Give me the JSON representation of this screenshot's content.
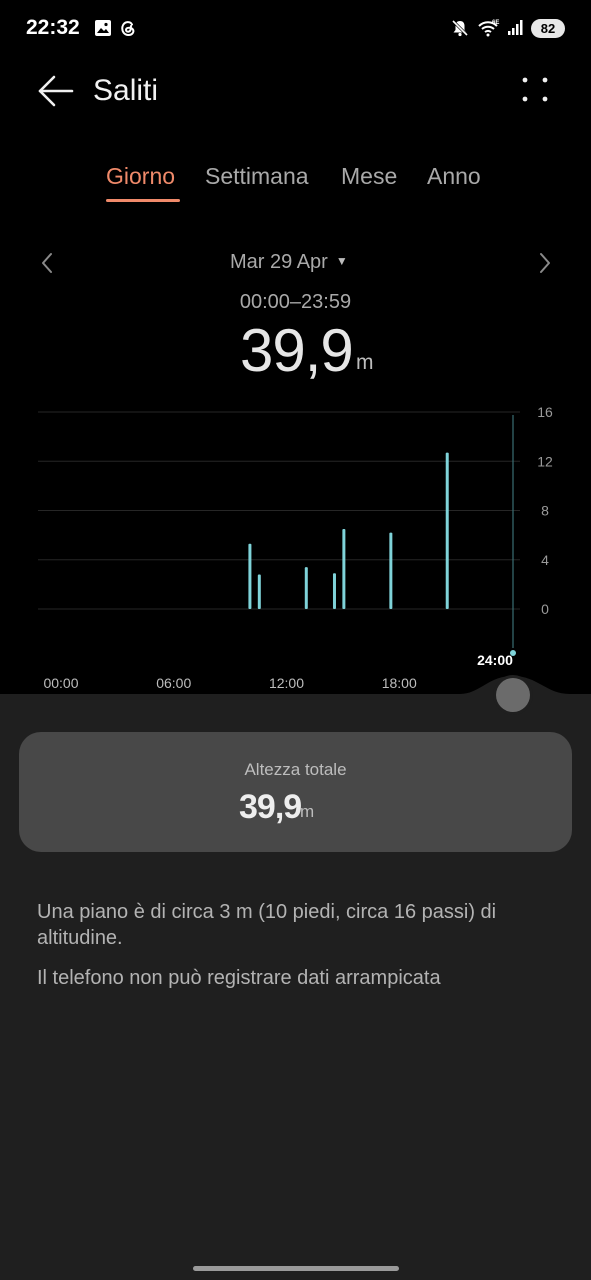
{
  "status_bar": {
    "time": "22:32",
    "battery": "82",
    "icons": [
      "gallery-icon",
      "threads-icon",
      "mute-icon",
      "wifi-6e-icon",
      "signal-icon"
    ]
  },
  "app_bar": {
    "title": "Saliti",
    "back_icon": "arrow-left-icon",
    "menu_icon": "more-dots-icon"
  },
  "tabs": [
    {
      "label": "Giorno",
      "active": true
    },
    {
      "label": "Settimana",
      "active": false
    },
    {
      "label": "Mese",
      "active": false
    },
    {
      "label": "Anno",
      "active": false
    }
  ],
  "date_nav": {
    "date": "Mar 29 Apr",
    "time_range": "00:00–23:59",
    "value": "39,9",
    "unit": "m"
  },
  "chart_data": {
    "type": "bar",
    "x_ticks": [
      "00:00",
      "06:00",
      "12:00",
      "18:00"
    ],
    "cursor_label": "24:00",
    "y_ticks": [
      "16",
      "12",
      "8",
      "4",
      "0"
    ],
    "ylim": [
      0,
      16
    ],
    "xlim_hours": [
      0,
      24
    ],
    "bar_color": "#7fd3d9",
    "points": [
      {
        "hour": 10.0,
        "value": 5.3
      },
      {
        "hour": 10.5,
        "value": 2.8
      },
      {
        "hour": 13.0,
        "value": 3.4
      },
      {
        "hour": 14.5,
        "value": 2.9
      },
      {
        "hour": 15.0,
        "value": 6.5
      },
      {
        "hour": 17.5,
        "value": 6.2
      },
      {
        "hour": 20.5,
        "value": 12.7
      }
    ]
  },
  "summary": {
    "label": "Altezza totale",
    "value": "39,9",
    "unit": "m"
  },
  "info": [
    "Una piano è di circa 3 m (10 piedi, circa 16 passi) di altitudine.",
    "Il telefono non può registrare dati arrampicata"
  ]
}
